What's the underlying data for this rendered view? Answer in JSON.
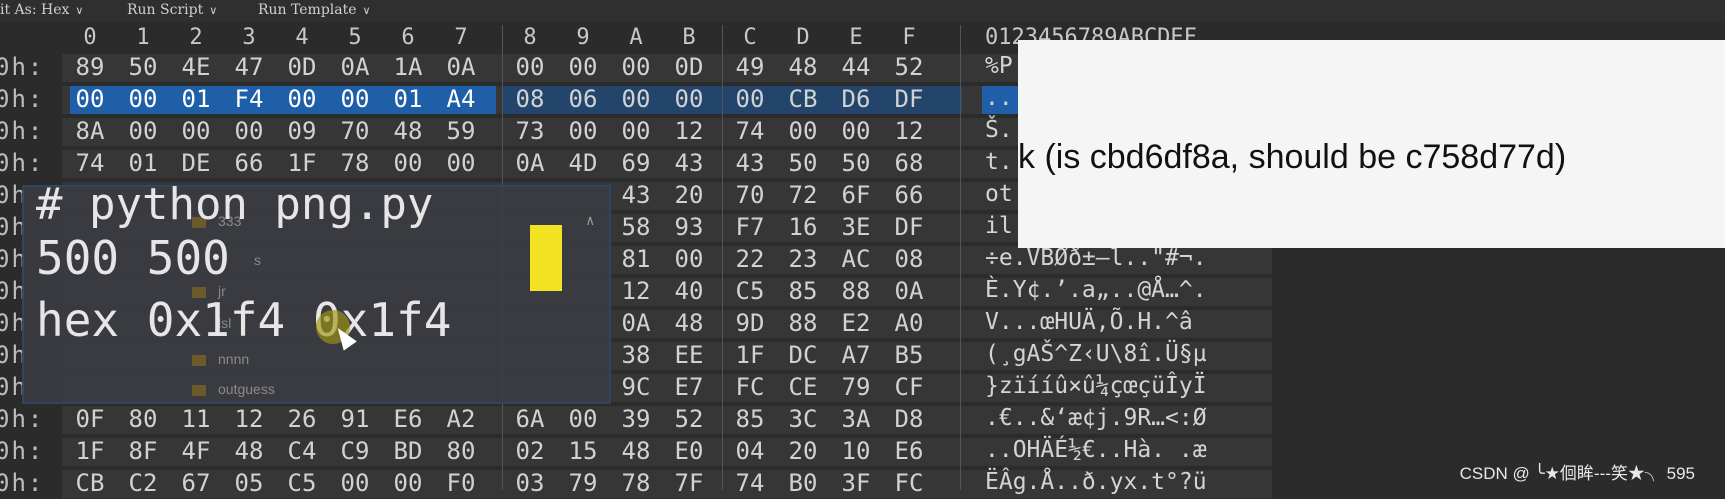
{
  "toolbar": {
    "edit_as": "it As: Hex",
    "run_script": "Run Script",
    "run_template": "Run Template"
  },
  "hex_view": {
    "column_headers": [
      "0",
      "1",
      "2",
      "3",
      "4",
      "5",
      "6",
      "7",
      "8",
      "9",
      "A",
      "B",
      "C",
      "D",
      "E",
      "F"
    ],
    "ascii_header": "0123456789ABCDEF",
    "rows": [
      {
        "addr": "0h:",
        "bytes": [
          "89",
          "50",
          "4E",
          "47",
          "0D",
          "0A",
          "1A",
          "0A",
          "00",
          "00",
          "00",
          "0D",
          "49",
          "48",
          "44",
          "52"
        ],
        "ascii": "%P"
      },
      {
        "addr": "0h:",
        "bytes": [
          "00",
          "00",
          "01",
          "F4",
          "00",
          "00",
          "01",
          "A4",
          "08",
          "06",
          "00",
          "00",
          "00",
          "CB",
          "D6",
          "DF"
        ],
        "ascii": ".."
      },
      {
        "addr": "0h:",
        "bytes": [
          "8A",
          "00",
          "00",
          "00",
          "09",
          "70",
          "48",
          "59",
          "73",
          "00",
          "00",
          "12",
          "74",
          "00",
          "00",
          "12"
        ],
        "ascii": "Š."
      },
      {
        "addr": "0h:",
        "bytes": [
          "74",
          "01",
          "DE",
          "66",
          "1F",
          "78",
          "00",
          "00",
          "0A",
          "4D",
          "69",
          "43",
          "43",
          "50",
          "50",
          "68"
        ],
        "ascii": "t."
      },
      {
        "addr": "0h",
        "bytes": [
          "",
          "",
          "",
          "",
          "",
          "",
          "",
          "",
          "",
          "",
          "43",
          "20",
          "70",
          "72",
          "6F",
          "66"
        ],
        "ascii": "ot"
      },
      {
        "addr": "0h",
        "bytes": [
          "",
          "",
          "",
          "",
          "",
          "",
          "",
          "",
          "",
          "",
          "58",
          "93",
          "F7",
          "16",
          "3E",
          "DF"
        ],
        "ascii": "il"
      },
      {
        "addr": "0h",
        "bytes": [
          "",
          "",
          "",
          "",
          "",
          "",
          "",
          "",
          "",
          "",
          "81",
          "00",
          "22",
          "23",
          "AC",
          "08"
        ],
        "ascii": "÷e.VBØð±—l..\"#¬."
      },
      {
        "addr": "0h",
        "bytes": [
          "",
          "",
          "",
          "",
          "",
          "",
          "",
          "",
          "",
          "",
          "12",
          "40",
          "C5",
          "85",
          "88",
          "0A"
        ],
        "ascii": "È.Y¢.’.a„..@Å…^."
      },
      {
        "addr": "0h",
        "bytes": [
          "",
          "",
          "",
          "",
          "",
          "",
          "",
          "",
          "",
          "",
          "0A",
          "48",
          "9D",
          "88",
          "E2",
          "A0"
        ],
        "ascii": "V...œHUÄ,Õ.H.^â"
      },
      {
        "addr": "0h",
        "bytes": [
          "",
          "",
          "",
          "",
          "",
          "",
          "",
          "",
          "",
          "",
          "38",
          "EE",
          "1F",
          "DC",
          "A7",
          "B5"
        ],
        "ascii": "(¸gAŠ^Z‹U\\8î.Ü§µ"
      },
      {
        "addr": "0h",
        "bytes": [
          "",
          "",
          "",
          "",
          "",
          "",
          "",
          "",
          "",
          "",
          "9C",
          "E7",
          "FC",
          "CE",
          "79",
          "CF"
        ],
        "ascii": "}zïííû×û¼çœçüÎyÏ"
      },
      {
        "addr": "0h:",
        "bytes": [
          "0F",
          "80",
          "11",
          "12",
          "26",
          "91",
          "E6",
          "A2",
          "6A",
          "00",
          "39",
          "52",
          "85",
          "3C",
          "3A",
          "D8"
        ],
        "ascii": ".€..&‘æ¢j.9R…<:Ø"
      },
      {
        "addr": "0h:",
        "bytes": [
          "1F",
          "8F",
          "4F",
          "48",
          "C4",
          "C9",
          "BD",
          "80",
          "02",
          "15",
          "48",
          "E0",
          "04",
          "20",
          "10",
          "E6"
        ],
        "ascii": "..OHÄÉ½€..Hà. .æ"
      },
      {
        "addr": "0h:",
        "bytes": [
          "CB",
          "C2",
          "67",
          "05",
          "C5",
          "00",
          "00",
          "F0",
          "03",
          "79",
          "78",
          "7F",
          "74",
          "B0",
          "3F",
          "FC"
        ],
        "ascii": "ËÂg.Å..ð.yx.t°?ü"
      }
    ]
  },
  "terminal": {
    "line1": "# python png.py",
    "line2": "500 500",
    "line3": "hex 0x1f4 0x1f4",
    "ghost_items": [
      "333",
      "s",
      "jr",
      "lsl",
      "nnnn",
      "outguess"
    ]
  },
  "error_popup": {
    "text": "k (is cbd6df8a, should be c758d77d)"
  },
  "watermark": "CSDN @ ╰★佪眸---笑★╮ 595"
}
